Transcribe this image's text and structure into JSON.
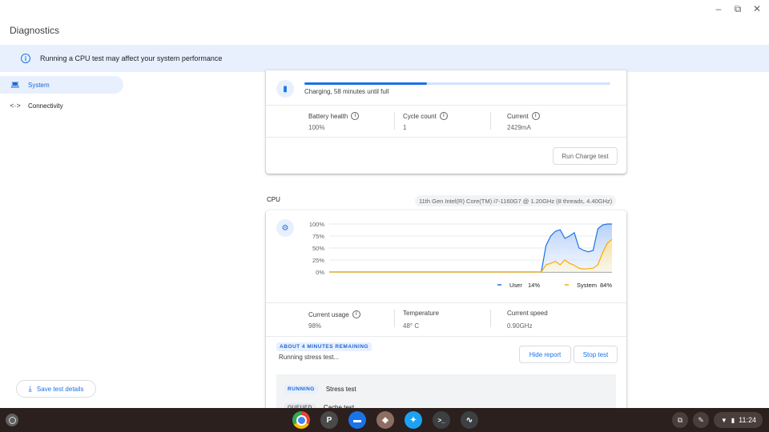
{
  "window": {
    "title": "Diagnostics",
    "controls": [
      "–",
      "⧉",
      "✕"
    ]
  },
  "banner": {
    "icon": "info-icon",
    "text": "Running a CPU test may affect your system performance"
  },
  "sidebar": {
    "items": [
      {
        "label": "System",
        "icon": "laptop-icon",
        "active": true
      },
      {
        "label": "Connectivity",
        "icon": "connectivity-icon",
        "active": false
      }
    ],
    "save_button": "Save test details"
  },
  "battery": {
    "progress_fraction": 0.4,
    "charging_text": "Charging, 58 minutes until full",
    "stats": [
      {
        "label": "Battery health",
        "value": "100%"
      },
      {
        "label": "Cycle count",
        "value": "1"
      },
      {
        "label": "Current",
        "value": "2429mA"
      }
    ],
    "run_button": "Run Charge test"
  },
  "cpu": {
    "section_label": "CPU",
    "model": "11th Gen Intel(R) Core(TM) i7-1160G7 @ 1.20GHz (8 threads, 4.40GHz)",
    "stats": [
      {
        "label": "Current usage",
        "value": "98%",
        "info": true
      },
      {
        "label": "Temperature",
        "value": "48° C",
        "info": false
      },
      {
        "label": "Current speed",
        "value": "0.90GHz",
        "info": false
      }
    ],
    "remaining_chip": "ABOUT 4 MINUTES REMAINING",
    "status_text": "Running stress test...",
    "hide_report": "Hide report",
    "stop_test": "Stop test",
    "routines": [
      {
        "badge": "RUNNING",
        "name": "Stress test"
      },
      {
        "badge": "QUEUED",
        "name": "Cache test"
      }
    ]
  },
  "chart_data": {
    "type": "area",
    "y_ticks": [
      "100%",
      "75%",
      "50%",
      "25%",
      "0%"
    ],
    "ylim": [
      0,
      100
    ],
    "x": [
      0,
      1,
      2,
      3,
      4,
      5,
      6,
      7,
      8,
      9,
      10,
      11,
      12,
      13,
      14,
      15,
      16,
      17,
      18,
      19,
      20,
      21,
      22,
      23,
      24,
      25,
      26,
      27,
      28,
      29,
      30,
      31,
      32,
      33,
      34,
      35,
      36,
      37,
      38,
      39,
      40,
      41,
      42,
      43,
      44,
      45,
      46,
      47,
      48,
      49,
      50,
      51,
      52,
      53,
      54,
      55,
      56,
      57,
      58,
      59,
      60
    ],
    "series": [
      {
        "name": "User",
        "legend_value": "14%",
        "color": "#1a73e8",
        "values": [
          0,
          0,
          0,
          0,
          0,
          0,
          0,
          0,
          0,
          0,
          0,
          0,
          0,
          0,
          0,
          0,
          0,
          0,
          0,
          0,
          0,
          0,
          0,
          0,
          0,
          0,
          0,
          0,
          0,
          0,
          0,
          0,
          0,
          0,
          0,
          0,
          0,
          0,
          0,
          0,
          0,
          0,
          0,
          0,
          0,
          0,
          55,
          75,
          85,
          88,
          70,
          75,
          82,
          50,
          45,
          42,
          45,
          90,
          98,
          100,
          100
        ]
      },
      {
        "name": "System",
        "legend_value": "84%",
        "color": "#f9ab00",
        "values": [
          0,
          0,
          0,
          0,
          0,
          0,
          0,
          0,
          0,
          0,
          0,
          0,
          0,
          0,
          0,
          0,
          0,
          0,
          0,
          0,
          0,
          0,
          0,
          0,
          0,
          0,
          0,
          0,
          0,
          0,
          0,
          0,
          0,
          0,
          0,
          0,
          0,
          0,
          0,
          0,
          0,
          0,
          0,
          0,
          0,
          0,
          15,
          18,
          22,
          15,
          25,
          18,
          14,
          8,
          6,
          7,
          8,
          15,
          40,
          60,
          68
        ]
      }
    ]
  },
  "shelf": {
    "apps": [
      {
        "name": "chrome-icon",
        "glyph": "",
        "color": "#ea4335"
      },
      {
        "name": "p-app-icon",
        "glyph": "P",
        "color": "#4a4a4a"
      },
      {
        "name": "files-icon",
        "glyph": "▬",
        "color": "#1a73e8"
      },
      {
        "name": "app-orange-icon",
        "glyph": "◈",
        "color": "#8d6e63"
      },
      {
        "name": "twitter-icon",
        "glyph": "✦",
        "color": "#1da1f2"
      },
      {
        "name": "terminal-icon",
        "glyph": ">_",
        "color": "#3c4043"
      },
      {
        "name": "diagnostics-icon",
        "glyph": "∿",
        "color": "#3c4043"
      }
    ],
    "time": "11:24"
  }
}
